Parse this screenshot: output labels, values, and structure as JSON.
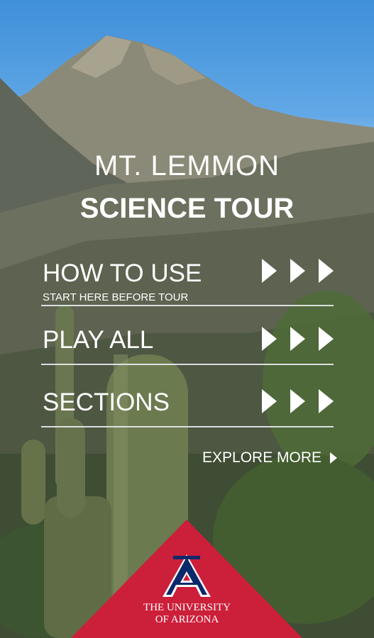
{
  "title": {
    "line1": "MT. LEMMON",
    "line2": "SCIENCE TOUR"
  },
  "menu": {
    "items": [
      {
        "label": "HOW TO USE",
        "sublabel": "START HERE BEFORE TOUR"
      },
      {
        "label": "PLAY ALL"
      },
      {
        "label": "SECTIONS"
      }
    ],
    "explore_label": "EXPLORE MORE"
  },
  "logo": {
    "letter": "A",
    "line1": "THE UNIVERSITY",
    "line2": "OF ARIZONA",
    "colors": {
      "red": "#cc1f3a",
      "navy": "#0c2a6b"
    }
  }
}
